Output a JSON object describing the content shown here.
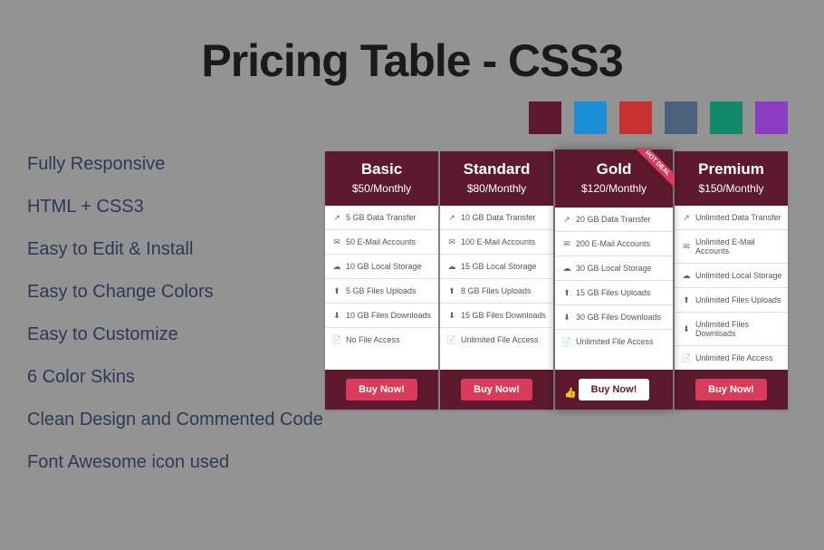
{
  "title": "Pricing Table - CSS3",
  "swatches": [
    "#5d1a2e",
    "#1a8fd6",
    "#c73030",
    "#4a6179",
    "#128a6a",
    "#8a3cc2"
  ],
  "features": [
    "Fully Responsive",
    "HTML + CSS3",
    "Easy to Edit & Install",
    "Easy to Change Colors",
    "Easy to Customize",
    "6 Color Skins",
    "Clean Design and Commented Code",
    "Font Awesome icon used"
  ],
  "hotdeal": "HOT DEAL",
  "buy": "Buy Now!",
  "plans": [
    {
      "name": "Basic",
      "price": "$50/Monthly",
      "feats": [
        "5 GB Data Transfer",
        "50 E-Mail Accounts",
        "10 GB Local Storage",
        "5 GB Files Uploads",
        "10 GB Files Downloads",
        "No File Access"
      ]
    },
    {
      "name": "Standard",
      "price": "$80/Monthly",
      "feats": [
        "10 GB Data Transfer",
        "100 E-Mail Accounts",
        "15 GB Local Storage",
        "8 GB Files Uploads",
        "15 GB Files Downloads",
        "Unlimited File Access"
      ]
    },
    {
      "name": "Gold",
      "price": "$120/Monthly",
      "gold": true,
      "feats": [
        "20 GB Data Transfer",
        "200 E-Mail Accounts",
        "30 GB Local Storage",
        "15 GB Files Uploads",
        "30 GB Files Downloads",
        "Unlimited File Access"
      ]
    },
    {
      "name": "Premium",
      "price": "$150/Monthly",
      "feats": [
        "Unlimited Data Transfer",
        "Unlimited E-Mail Accounts",
        "Unlimited Local Storage",
        "Unlimited Files Uploads",
        "Unlimited Files Downloads",
        "Unlimited File Access"
      ]
    }
  ],
  "icons": [
    "↗",
    "✉",
    "☁",
    "⬆",
    "⬇",
    "📄"
  ]
}
